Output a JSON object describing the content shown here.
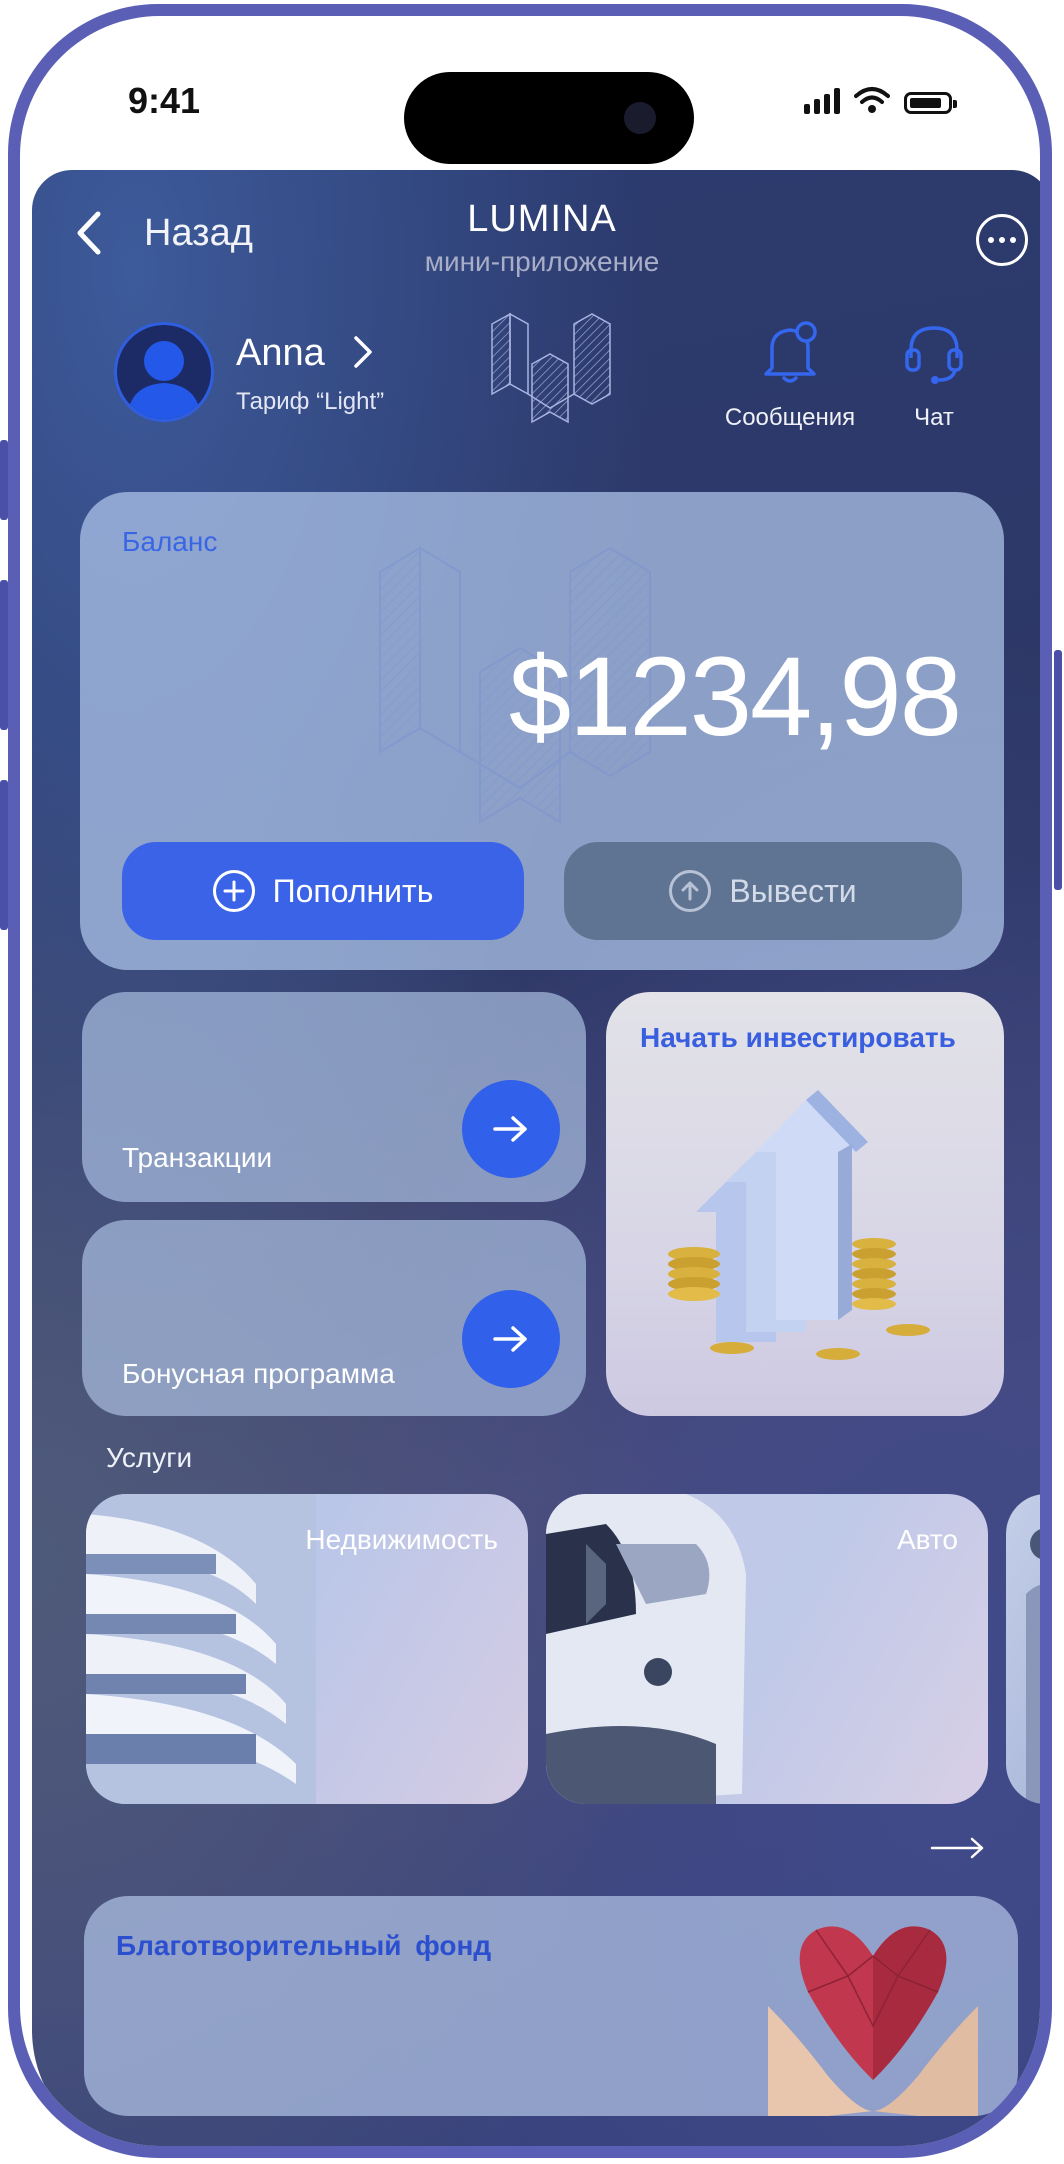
{
  "status_bar": {
    "time": "9:41"
  },
  "header": {
    "back_label": "Назад",
    "title": "LUMINA",
    "subtitle": "мини-приложение"
  },
  "user": {
    "name": "Anna",
    "plan": "Тариф “Light”"
  },
  "quick_actions": [
    {
      "label": "Сообщения",
      "icon": "bell-icon"
    },
    {
      "label": "Чат",
      "icon": "headset-icon"
    }
  ],
  "balance": {
    "label": "Баланс",
    "amount": "$1234,98",
    "deposit_label": "Пополнить",
    "withdraw_label": "Вывести"
  },
  "tiles": {
    "transactions": "Транзакции",
    "bonus": "Бонусная программа",
    "invest": "Начать инвестировать"
  },
  "services": {
    "title": "Услуги",
    "items": [
      {
        "label": "Недвижимость"
      },
      {
        "label": "Авто"
      },
      {
        "label": ""
      }
    ]
  },
  "charity": {
    "title": "Благотворительный фонд"
  },
  "colors": {
    "accent": "#3a63e8",
    "accent_text": "#3a5ee0",
    "frame": "#5a5fb5"
  }
}
